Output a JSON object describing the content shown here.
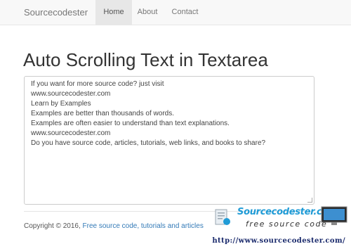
{
  "navbar": {
    "brand": "Sourcecodester",
    "items": [
      {
        "label": "Home"
      },
      {
        "label": "About"
      },
      {
        "label": "Contact"
      }
    ]
  },
  "main": {
    "title": "Auto Scrolling Text in Textarea",
    "textarea_lines": [
      "If you want for more source code? just visit",
      "www.sourcecodester.com",
      "Learn by Examples",
      "Examples are better than thousands of words.",
      "Examples are often easier to understand than text explanations.",
      "www.sourcecodester.com",
      "Do you have source code, articles, tutorials, web links, and books to share?"
    ]
  },
  "footer": {
    "copyright": "Copyright © 2016,",
    "link_text": "Free source code, tutorials and articles"
  },
  "watermark": {
    "title": "Sourcecodester.com",
    "subtitle": "free source code",
    "url": "http://www.sourcecodester.com/",
    "accent": "#1f9bd6"
  },
  "colors": {
    "navbar_bg": "#f8f8f8",
    "active_nav_bg": "#e7e7e7",
    "link": "#337ab7"
  }
}
